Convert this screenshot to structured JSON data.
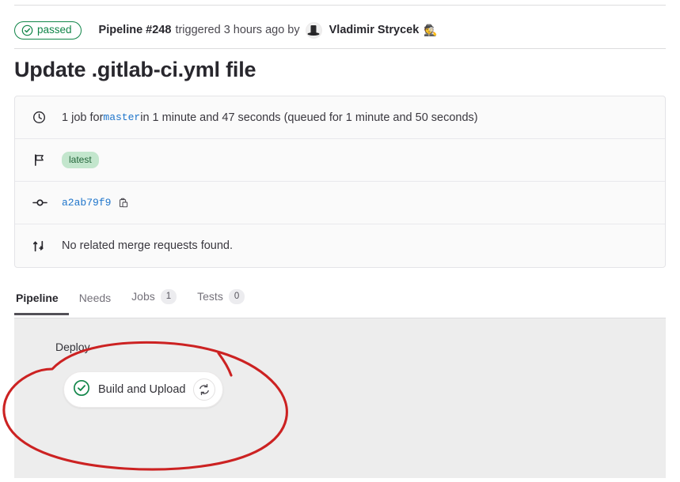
{
  "header": {
    "status_label": "passed",
    "status_color": "#108548",
    "pipeline_label": "Pipeline #248",
    "triggered_text": "triggered 3 hours ago by",
    "user_name": "Vladimir Strycek",
    "user_emoji": "🕵️",
    "avatar_icon": "user-avatar"
  },
  "page_title": "Update .gitlab-ci.yml file",
  "info_card": {
    "rows": [
      {
        "icon": "clock-icon",
        "prefix": "1 job for ",
        "branch": "master",
        "suffix": " in 1 minute and 47 seconds (queued for 1 minute and 50 seconds)"
      },
      {
        "icon": "flag-icon",
        "badge": "latest"
      },
      {
        "icon": "commit-icon",
        "sha": "a2ab79f9",
        "copy_icon": "copy-to-clipboard-icon"
      },
      {
        "icon": "merge-request-icon",
        "text": "No related merge requests found."
      }
    ]
  },
  "tabs": [
    {
      "label": "Pipeline",
      "badge": null,
      "active": true
    },
    {
      "label": "Needs",
      "badge": null,
      "active": false
    },
    {
      "label": "Jobs",
      "badge": "1",
      "active": false
    },
    {
      "label": "Tests",
      "badge": "0",
      "active": false
    }
  ],
  "graph": {
    "stage_name": "Deploy",
    "job": {
      "status_icon": "status-success-icon",
      "name": "Build and Upload",
      "retry_icon": "retry-icon"
    },
    "annotation": {
      "shape": "hand-drawn-ellipse",
      "color": "#cc2222"
    }
  }
}
